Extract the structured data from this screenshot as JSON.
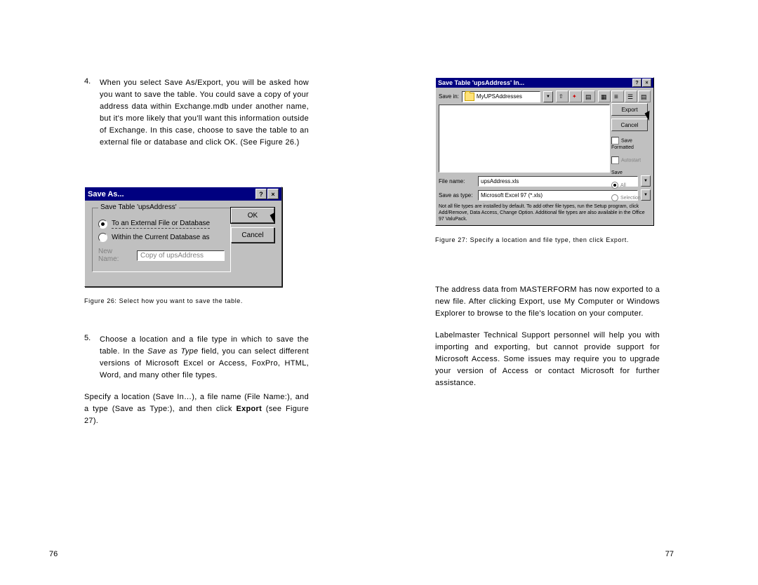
{
  "left": {
    "item4_num": "4.",
    "item4_text": "When you select Save As/Export, you will be asked how you want to save the table. You could save a copy of your address data within Exchange.mdb under another name, but it's more likely that you'll want this information outside of Exchange. In this case, choose to save the table to an external file or database and click OK. (See Figure 26.)",
    "fig26_caption": "Figure 26: Select how you want to save the table.",
    "item5_num": "5.",
    "item5_text_pre": "Choose a location and a file type in which to save the table. In the ",
    "item5_text_em": "Save as Type",
    "item5_text_post": " field, you can select different versions of Microsoft Excel or Access, FoxPro, HTML, Word, and many other file types.",
    "para3_pre": "Specify a location (Save In…), a file name (File Name:), and a type (Save as Type:), and then click ",
    "para3_b": "Export",
    "para3_post": " (see Figure 27).",
    "page_num": "76"
  },
  "right": {
    "fig27_caption": "Figure 27: Specify a location and file type, then click Export.",
    "para1": "The address data from MASTERFORM has now exported to a new file. After clicking Export, use My Computer or Windows Explorer to browse to the file's location on your computer.",
    "para2": "Labelmaster Technical Support personnel will help you with importing and exporting, but cannot provide support for Microsoft Access. Some issues may require you to upgrade your version of Access or contact Microsoft for further assistance.",
    "page_num": "77"
  },
  "saveas": {
    "title": "Save As...",
    "group_title": "Save Table 'upsAddress'",
    "radio1": "To an External File or Database",
    "radio2": "Within the Current Database as",
    "newname_label": "New Name:",
    "newname_value": "Copy of upsAddress",
    "ok": "OK",
    "cancel": "Cancel"
  },
  "filedlg": {
    "title": "Save Table 'upsAddress' In...",
    "savein_label": "Save in:",
    "folder": "MyUPSAddresses",
    "export_btn": "Export",
    "cancel_btn": "Cancel",
    "chk_saveformatted": "Save Formatted",
    "chk_autostart": "Autostart",
    "save_section": "Save",
    "radio_all": "All",
    "radio_selection": "Selection",
    "filename_label": "File name:",
    "filename_value": "upsAddress.xls",
    "savetype_label": "Save as type:",
    "savetype_value": "Microsoft Excel 97 (*.xls)",
    "hint": "Not all file types are installed by default. To add other file types, run the Setup program, click Add/Remove, Data Access, Change Option. Additional file types are also available in the Office 97 ValuPack."
  }
}
